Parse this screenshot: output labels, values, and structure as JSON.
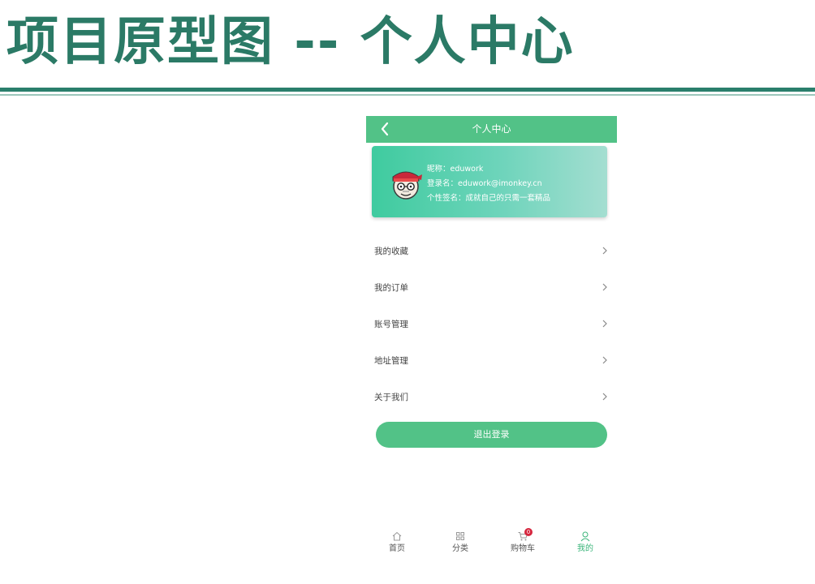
{
  "slide": {
    "title": "项目原型图 -- 个人中心"
  },
  "header": {
    "title": "个人中心"
  },
  "profile": {
    "nickname_line": "昵称：eduwork",
    "login_line": "登录名：eduwork@imonkey.cn",
    "signature_line": "个性签名：成就自己的只需一套精品"
  },
  "menu": {
    "items": [
      {
        "label": "我的收藏"
      },
      {
        "label": "我的订单"
      },
      {
        "label": "账号管理"
      },
      {
        "label": "地址管理"
      },
      {
        "label": "关于我们"
      }
    ]
  },
  "logout": {
    "label": "退出登录"
  },
  "tabbar": {
    "items": [
      {
        "label": "首页",
        "icon": "home-icon"
      },
      {
        "label": "分类",
        "icon": "grid-icon"
      },
      {
        "label": "购物车",
        "icon": "cart-icon",
        "badge": "0"
      },
      {
        "label": "我的",
        "icon": "user-icon",
        "active": true
      }
    ]
  },
  "colors": {
    "title": "#2b7a66",
    "brand_green": "#52c287",
    "badge_red": "#d6263e"
  }
}
